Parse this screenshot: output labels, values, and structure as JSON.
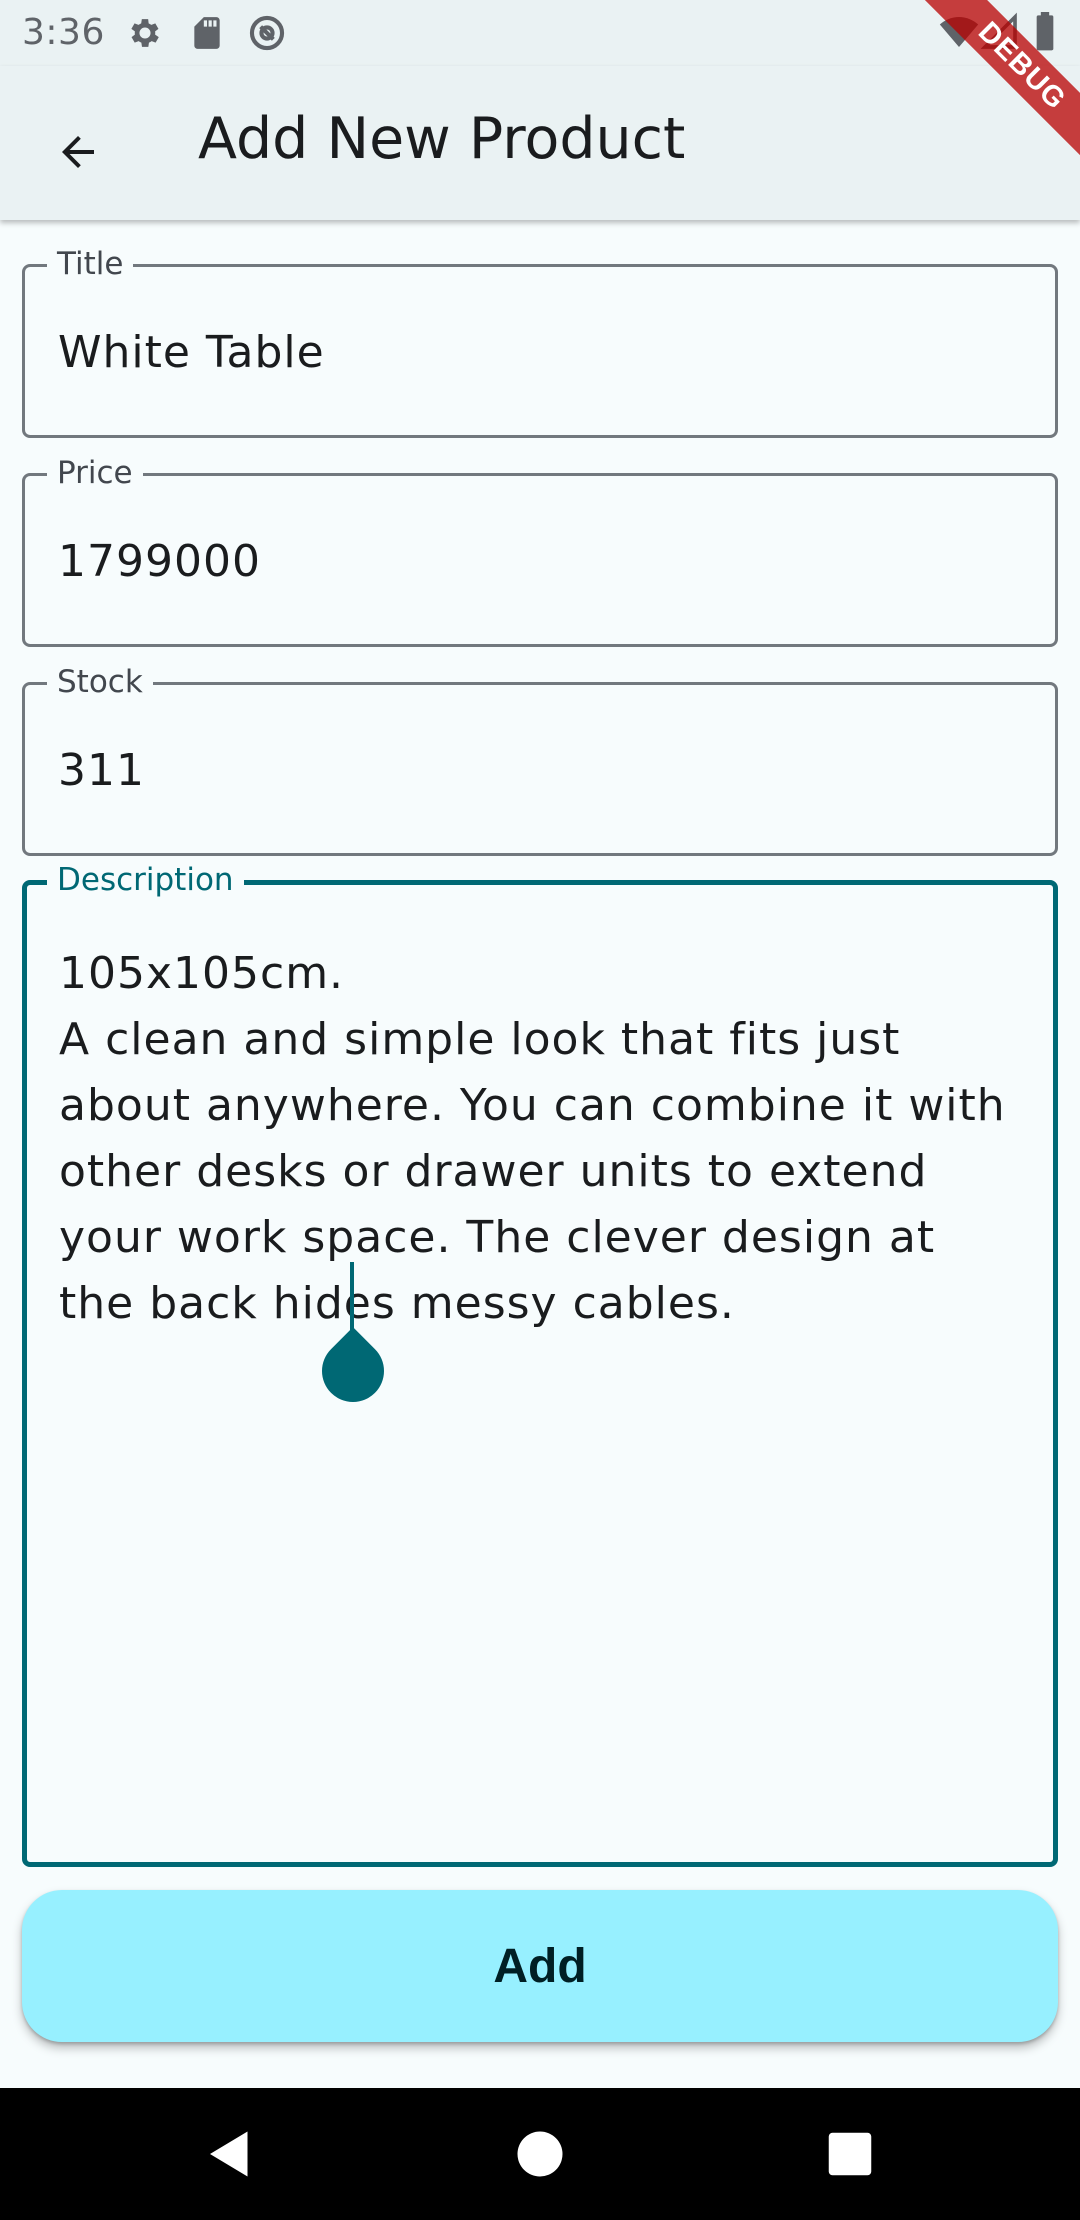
{
  "status_bar": {
    "time": "3:36",
    "left_icons": [
      "settings-icon",
      "sd-card-icon",
      "at-sign-icon"
    ],
    "right_icons": [
      "wifi-icon",
      "signal-icon",
      "battery-icon"
    ]
  },
  "app_bar": {
    "back_icon": "arrow-back-icon",
    "title": "Add New Product"
  },
  "debug_banner": "DEBUG",
  "form": {
    "title": {
      "label": "Title",
      "value": "White Table"
    },
    "price": {
      "label": "Price",
      "value": "1799000"
    },
    "stock": {
      "label": "Stock",
      "value": "311"
    },
    "description": {
      "label": "Description",
      "value": "105x105cm.\nA clean and simple look that fits just about anywhere. You can combine it with other desks or drawer units to extend your work space. The clever design at the back hides messy cables."
    }
  },
  "add_button": {
    "label": "Add"
  },
  "nav_bar": {
    "icons": [
      "back-triangle-icon",
      "home-circle-icon",
      "recents-square-icon"
    ]
  },
  "colors": {
    "primary": "#006874",
    "button_bg": "#97f0ff",
    "app_bar_bg": "#eaf2f3",
    "page_bg": "#f7fcfd",
    "outline": "#72787e"
  }
}
